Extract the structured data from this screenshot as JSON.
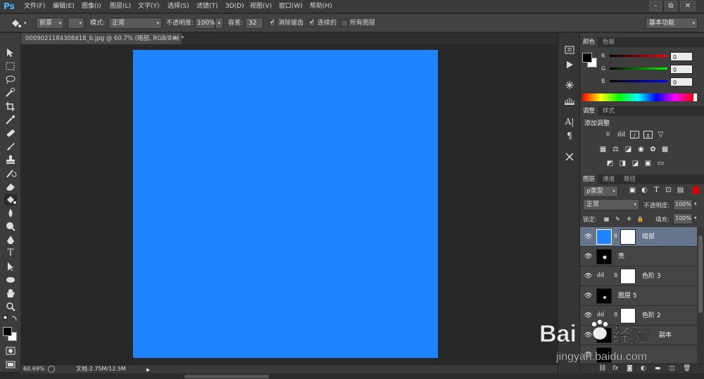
{
  "app": {
    "logo": "Ps",
    "menus": [
      "文件(F)",
      "编辑(E)",
      "图像(I)",
      "图层(L)",
      "文字(Y)",
      "选择(S)",
      "滤镜(T)",
      "3D(D)",
      "视图(V)",
      "窗口(W)",
      "帮助(H)"
    ],
    "window_buttons": [
      "–",
      "⧉",
      "✕"
    ]
  },
  "options": {
    "fill_source": "前景",
    "mode_label": "模式:",
    "mode_value": "正常",
    "opacity_label": "不透明度:",
    "opacity_value": "100%",
    "tolerance_label": "容差:",
    "tolerance_value": "32",
    "antialias_label": "消除锯齿",
    "contiguous_label": "连续的",
    "all_layers_label": "所有图层",
    "workspace": "基本功能"
  },
  "document": {
    "tab_title": "0009021184308418_b.jpg @ 60.7% (暗部, RGB/8#) *",
    "close": "×",
    "canvas_color": "#1f84ff"
  },
  "status": {
    "zoom": "60.69%",
    "doc_info": "文档:2.75M/12.5M"
  },
  "color_panel": {
    "tabs": [
      "颜色",
      "色板"
    ],
    "channels": [
      {
        "label": "R",
        "value": "0",
        "color": "#d02020"
      },
      {
        "label": "G",
        "value": "0",
        "color": "#20a020"
      },
      {
        "label": "B",
        "value": "0",
        "color": "#2030d0"
      }
    ]
  },
  "adjust_panel": {
    "tabs": [
      "调整",
      "样式"
    ],
    "title": "添加调整"
  },
  "layers_panel": {
    "tabs": [
      "图层",
      "通道",
      "路径"
    ],
    "filter": "ρ类型",
    "blend_mode": "正常",
    "opacity_label": "不透明度:",
    "opacity_value": "100%",
    "lock_label": "锁定:",
    "fill_label": "填充:",
    "fill_value": "100%",
    "layers": [
      {
        "name": "暗部",
        "selected": true,
        "type": "fill-mask",
        "color": "#1f84ff"
      },
      {
        "name": "亮",
        "selected": false,
        "type": "black"
      },
      {
        "name": "色阶 3",
        "selected": false,
        "type": "adjust-mask"
      },
      {
        "name": "图层 5",
        "selected": false,
        "type": "black"
      },
      {
        "name": "色阶 2",
        "selected": false,
        "type": "adjust-mask"
      },
      {
        "name": "副本",
        "selected": false,
        "type": "black"
      },
      {
        "name": "",
        "selected": false,
        "type": "black"
      }
    ],
    "footer_icons": [
      "link-icon",
      "fx-icon",
      "mask-icon",
      "adjustment-icon",
      "group-icon",
      "new-layer-icon",
      "trash-icon"
    ]
  },
  "watermark": {
    "brand": "Bai",
    "brand_suffix": "经验",
    "url": "jingyan.baidu.com"
  }
}
